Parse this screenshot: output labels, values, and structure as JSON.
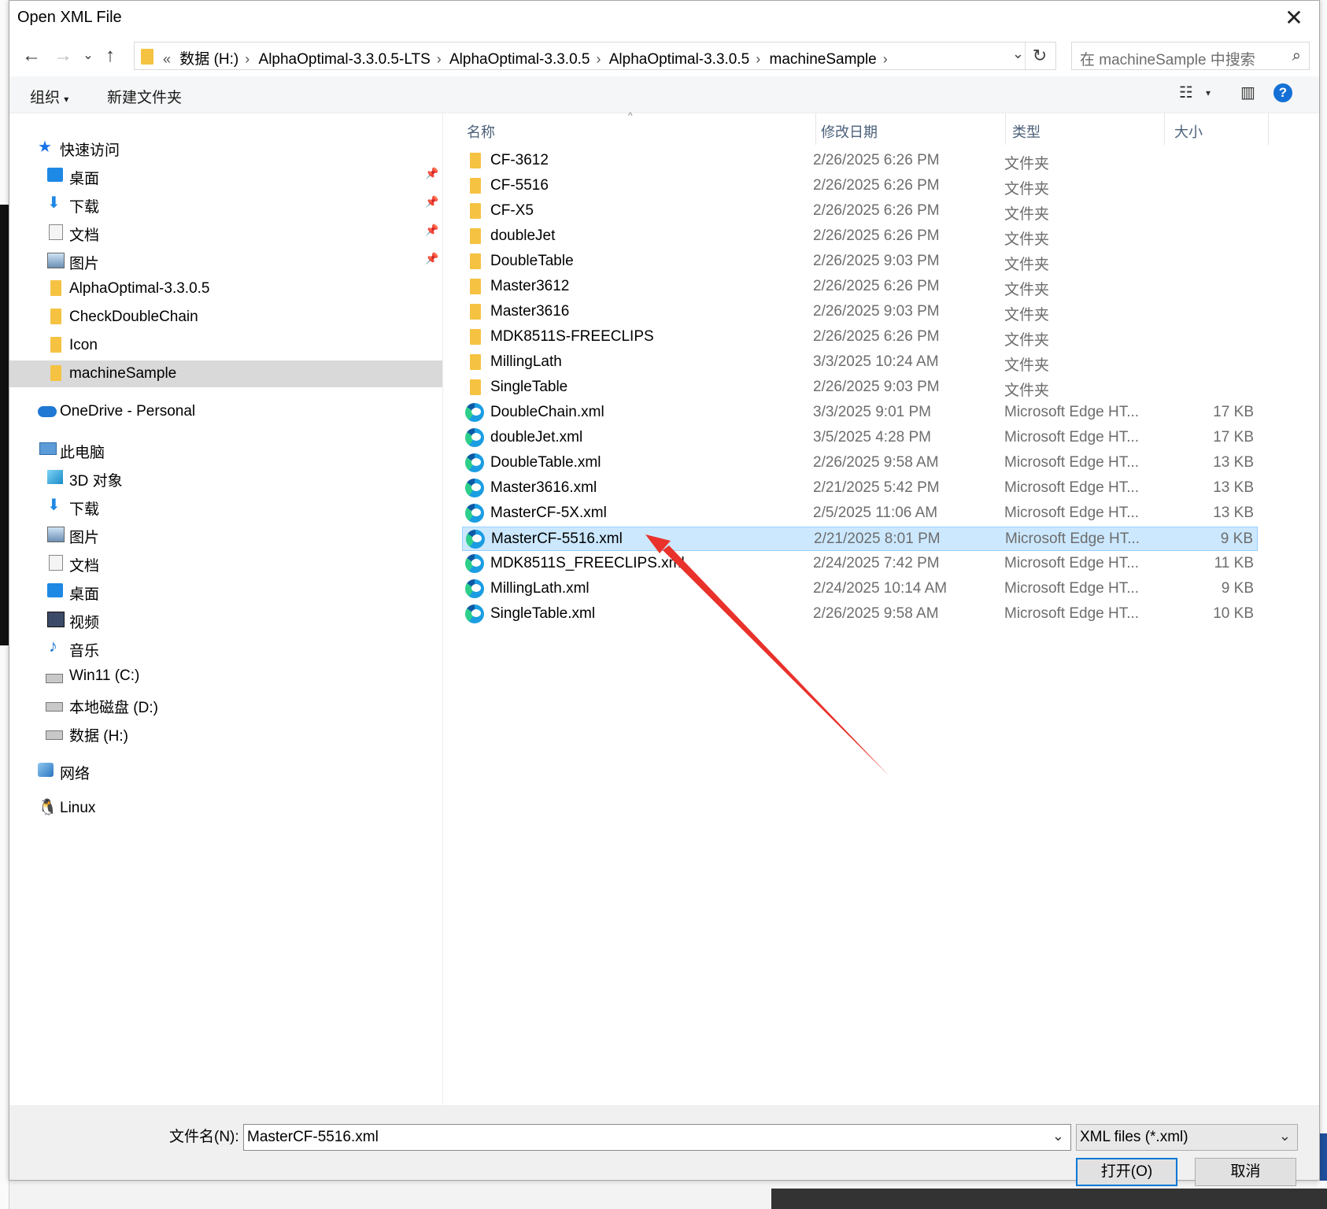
{
  "window": {
    "title": "Open XML File"
  },
  "nav": {
    "breadcrumb": [
      "数据 (H:)",
      "AlphaOptimal-3.3.0.5-LTS",
      "AlphaOptimal-3.3.0.5",
      "AlphaOptimal-3.3.0.5",
      "machineSample"
    ],
    "overflow": "«",
    "search_placeholder": "在 machineSample 中搜索"
  },
  "toolbar": {
    "organize": "组织",
    "new_folder": "新建文件夹"
  },
  "sidebar": {
    "quick_access": "快速访问",
    "quick_items": [
      "桌面",
      "下载",
      "文档",
      "图片",
      "AlphaOptimal-3.3.0.5",
      "CheckDoubleChain",
      "Icon",
      "machineSample"
    ],
    "onedrive": "OneDrive - Personal",
    "this_pc": "此电脑",
    "pc_items": [
      "3D 对象",
      "下载",
      "图片",
      "文档",
      "桌面",
      "视频",
      "音乐",
      "Win11 (C:)",
      "本地磁盘 (D:)",
      "数据 (H:)"
    ],
    "network": "网络",
    "linux": "Linux"
  },
  "columns": {
    "name": "名称",
    "date": "修改日期",
    "type": "类型",
    "size": "大小"
  },
  "files": [
    {
      "name": "CF-3612",
      "date": "2/26/2025 6:26 PM",
      "type": "文件夹",
      "size": "",
      "kind": "folder"
    },
    {
      "name": "CF-5516",
      "date": "2/26/2025 6:26 PM",
      "type": "文件夹",
      "size": "",
      "kind": "folder"
    },
    {
      "name": "CF-X5",
      "date": "2/26/2025 6:26 PM",
      "type": "文件夹",
      "size": "",
      "kind": "folder"
    },
    {
      "name": "doubleJet",
      "date": "2/26/2025 6:26 PM",
      "type": "文件夹",
      "size": "",
      "kind": "folder"
    },
    {
      "name": "DoubleTable",
      "date": "2/26/2025 9:03 PM",
      "type": "文件夹",
      "size": "",
      "kind": "folder"
    },
    {
      "name": "Master3612",
      "date": "2/26/2025 6:26 PM",
      "type": "文件夹",
      "size": "",
      "kind": "folder"
    },
    {
      "name": "Master3616",
      "date": "2/26/2025 9:03 PM",
      "type": "文件夹",
      "size": "",
      "kind": "folder"
    },
    {
      "name": "MDK8511S-FREECLIPS",
      "date": "2/26/2025 6:26 PM",
      "type": "文件夹",
      "size": "",
      "kind": "folder"
    },
    {
      "name": "MillingLath",
      "date": "3/3/2025 10:24 AM",
      "type": "文件夹",
      "size": "",
      "kind": "folder"
    },
    {
      "name": "SingleTable",
      "date": "2/26/2025 9:03 PM",
      "type": "文件夹",
      "size": "",
      "kind": "folder"
    },
    {
      "name": "DoubleChain.xml",
      "date": "3/3/2025 9:01 PM",
      "type": "Microsoft Edge HT...",
      "size": "17 KB",
      "kind": "edge"
    },
    {
      "name": "doubleJet.xml",
      "date": "3/5/2025 4:28 PM",
      "type": "Microsoft Edge HT...",
      "size": "17 KB",
      "kind": "edge"
    },
    {
      "name": "DoubleTable.xml",
      "date": "2/26/2025 9:58 AM",
      "type": "Microsoft Edge HT...",
      "size": "13 KB",
      "kind": "edge"
    },
    {
      "name": "Master3616.xml",
      "date": "2/21/2025 5:42 PM",
      "type": "Microsoft Edge HT...",
      "size": "13 KB",
      "kind": "edge"
    },
    {
      "name": "MasterCF-5X.xml",
      "date": "2/5/2025 11:06 AM",
      "type": "Microsoft Edge HT...",
      "size": "13 KB",
      "kind": "edge"
    },
    {
      "name": "MasterCF-5516.xml",
      "date": "2/21/2025 8:01 PM",
      "type": "Microsoft Edge HT...",
      "size": "9 KB",
      "kind": "edge",
      "selected": true
    },
    {
      "name": "MDK8511S_FREECLIPS.xml",
      "date": "2/24/2025 7:42 PM",
      "type": "Microsoft Edge HT...",
      "size": "11 KB",
      "kind": "edge"
    },
    {
      "name": "MillingLath.xml",
      "date": "2/24/2025 10:14 AM",
      "type": "Microsoft Edge HT...",
      "size": "9 KB",
      "kind": "edge"
    },
    {
      "name": "SingleTable.xml",
      "date": "2/26/2025 9:58 AM",
      "type": "Microsoft Edge HT...",
      "size": "10 KB",
      "kind": "edge"
    }
  ],
  "footer": {
    "filename_label": "文件名(N):",
    "filename_value": "MasterCF-5516.xml",
    "filetype_value": "XML files (*.xml)",
    "open_label": "打开(O)",
    "cancel_label": "取消"
  },
  "colors": {
    "accent": "#0078d7",
    "selection": "#cce8ff",
    "arrow": "#e8322b",
    "folder": "#f5c242"
  }
}
